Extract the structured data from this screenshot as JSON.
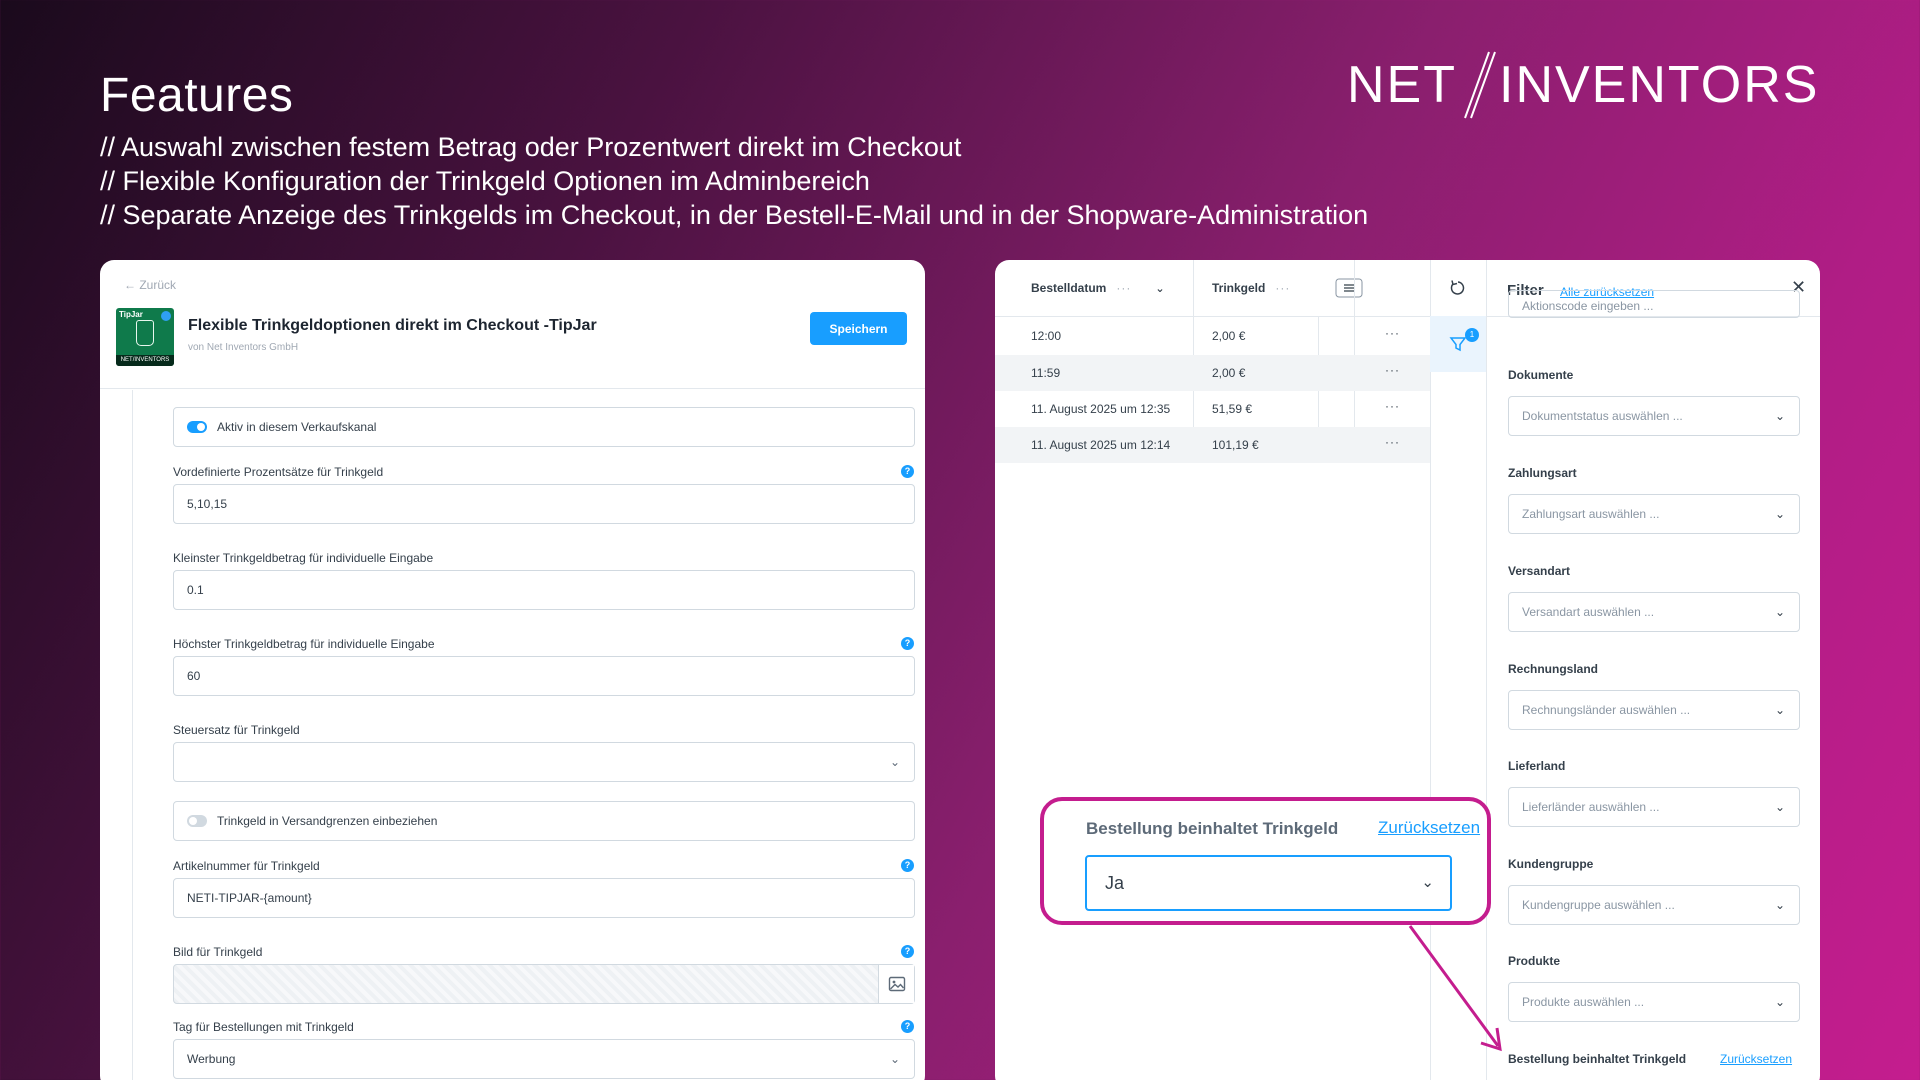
{
  "slide": {
    "title": "Features",
    "bullets": [
      "// Auswahl zwischen festem Betrag oder Prozentwert direkt im Checkout",
      "// Flexible Konfiguration der Trinkgeld Optionen im Adminbereich",
      "// Separate Anzeige des Trinkgelds im Checkout, in der Bestell-E-Mail und in der Shopware-Administration"
    ],
    "logo_left": "NET",
    "logo_right": "INVENTORS"
  },
  "config": {
    "back": "← Zurück",
    "icon_label": "TipJar",
    "icon_footer": "NET/INVENTORS",
    "plugin_title": "Flexible Trinkgeldoptionen direkt im Checkout -TipJar",
    "vendor": "von Net Inventors GmbH",
    "save_label": "Speichern",
    "active_label": "Aktiv in diesem Verkaufskanal",
    "percent_label": "Vordefinierte Prozentsätze für Trinkgeld",
    "percent_value": "5,10,15",
    "min_label": "Kleinster Trinkgeldbetrag für individuelle Eingabe",
    "min_value": "0.1",
    "max_label": "Höchster Trinkgeldbetrag für individuelle Eingabe",
    "max_value": "60",
    "tax_label": "Steuersatz für Trinkgeld",
    "tax_value": "",
    "shipping_label": "Trinkgeld in Versandgrenzen einbeziehen",
    "sku_label": "Artikelnummer für Trinkgeld",
    "sku_value": "NETI-TIPJAR-{amount}",
    "image_label": "Bild für Trinkgeld",
    "tag_label": "Tag für Bestellungen mit Trinkgeld",
    "tag_value": "Werbung"
  },
  "orders": {
    "columns": [
      "Bestelldatum",
      "Trinkgeld"
    ],
    "rows": [
      {
        "date": "12:00",
        "tip": "2,00 €"
      },
      {
        "date": "11:59",
        "tip": "2,00 €"
      },
      {
        "date": "11. August 2025 um 12:35",
        "tip": "51,59 €"
      },
      {
        "date": "11. August 2025 um 12:14",
        "tip": "101,19 €"
      }
    ]
  },
  "filter": {
    "title": "Filter",
    "reset_all": "Alle zurücksetzen",
    "badge": "1",
    "partial_placeholder": "Aktionscode eingeben ...",
    "groups": [
      {
        "label": "Dokumente",
        "placeholder": "Dokumentstatus auswählen ..."
      },
      {
        "label": "Zahlungsart",
        "placeholder": "Zahlungsart auswählen ..."
      },
      {
        "label": "Versandart",
        "placeholder": "Versandart auswählen ..."
      },
      {
        "label": "Rechnungsland",
        "placeholder": "Rechnungsländer auswählen ..."
      },
      {
        "label": "Lieferland",
        "placeholder": "Lieferländer auswählen ..."
      },
      {
        "label": "Kundengruppe",
        "placeholder": "Kundengruppe auswählen ..."
      },
      {
        "label": "Produkte",
        "placeholder": "Produkte auswählen ..."
      }
    ],
    "tip_filter_label": "Bestellung beinhaltet Trinkgeld",
    "tip_filter_reset": "Zurücksetzen",
    "tip_filter_reset_small": "Zurücksetzen",
    "tip_filter_value": "Ja"
  },
  "colors": {
    "accent": "#189eff",
    "callout": "#c41d8e"
  }
}
